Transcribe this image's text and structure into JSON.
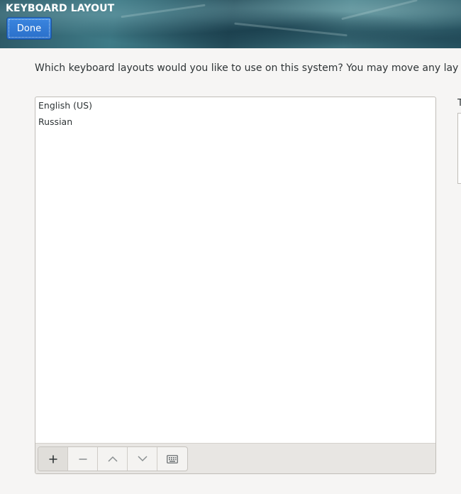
{
  "header": {
    "title": "KEYBOARD LAYOUT",
    "done_label": "Done"
  },
  "main": {
    "question": "Which keyboard layouts would you like to use on this system?  You may move any lay",
    "layouts": [
      "English (US)",
      "Russian"
    ],
    "toolbar": {
      "buttons": [
        "add-icon",
        "remove-icon",
        "move-up-icon",
        "move-down-icon",
        "keyboard-icon"
      ]
    }
  },
  "side": {
    "label": "T"
  }
}
